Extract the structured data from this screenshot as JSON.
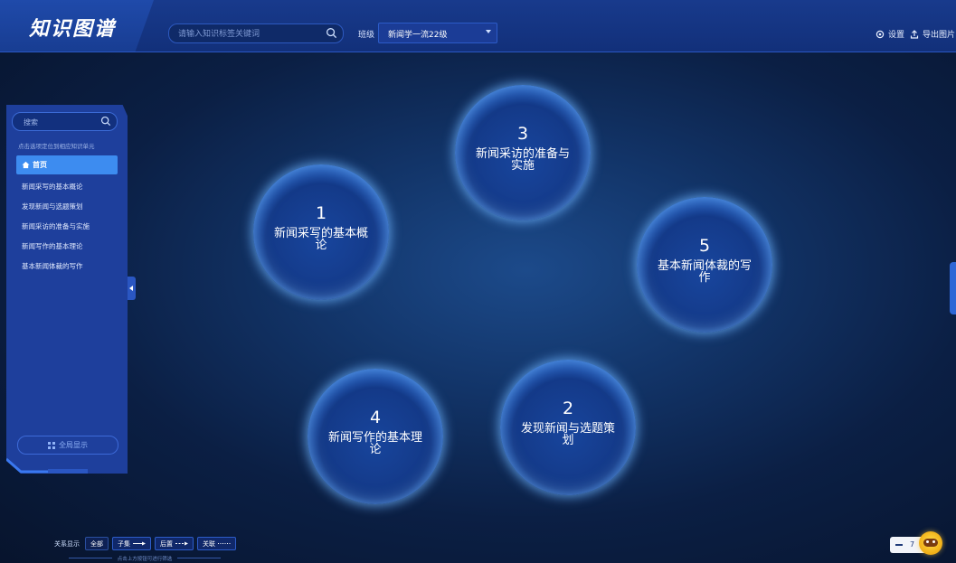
{
  "header": {
    "logo": "知识图谱",
    "search_placeholder": "请输入知识标签关键词",
    "class_label": "班级",
    "class_value": "新闻学一流22级",
    "settings_label": "设置",
    "export_label": "导出图片"
  },
  "sidebar": {
    "search_placeholder": "搜索",
    "hint": "点击选项定位到相应知识单元",
    "home_label": "首页",
    "items": [
      {
        "label": "新闻采写的基本概论"
      },
      {
        "label": "发现新闻与选题策划"
      },
      {
        "label": "新闻采访的准备与实施"
      },
      {
        "label": "新闻写作的基本理论"
      },
      {
        "label": "基本新闻体裁的写作"
      }
    ],
    "fullview_label": "全局显示"
  },
  "nodes": [
    {
      "num": "1",
      "label": "新闻采写的基本概论"
    },
    {
      "num": "2",
      "label": "发现新闻与选题策划"
    },
    {
      "num": "3",
      "label": "新闻采访的准备与实施"
    },
    {
      "num": "4",
      "label": "新闻写作的基本理论"
    },
    {
      "num": "5",
      "label": "基本新闻体裁的写作"
    }
  ],
  "legend": {
    "label": "关系显示",
    "all": "全部",
    "child": "子集",
    "post": "后置",
    "relate": "关联",
    "hint": "点击上方按钮可进行筛选"
  },
  "zoom": {
    "value": "7"
  },
  "colors": {
    "accent": "#3d8cf0",
    "header": "#183a8c",
    "sidebar": "#1e3f9c"
  }
}
